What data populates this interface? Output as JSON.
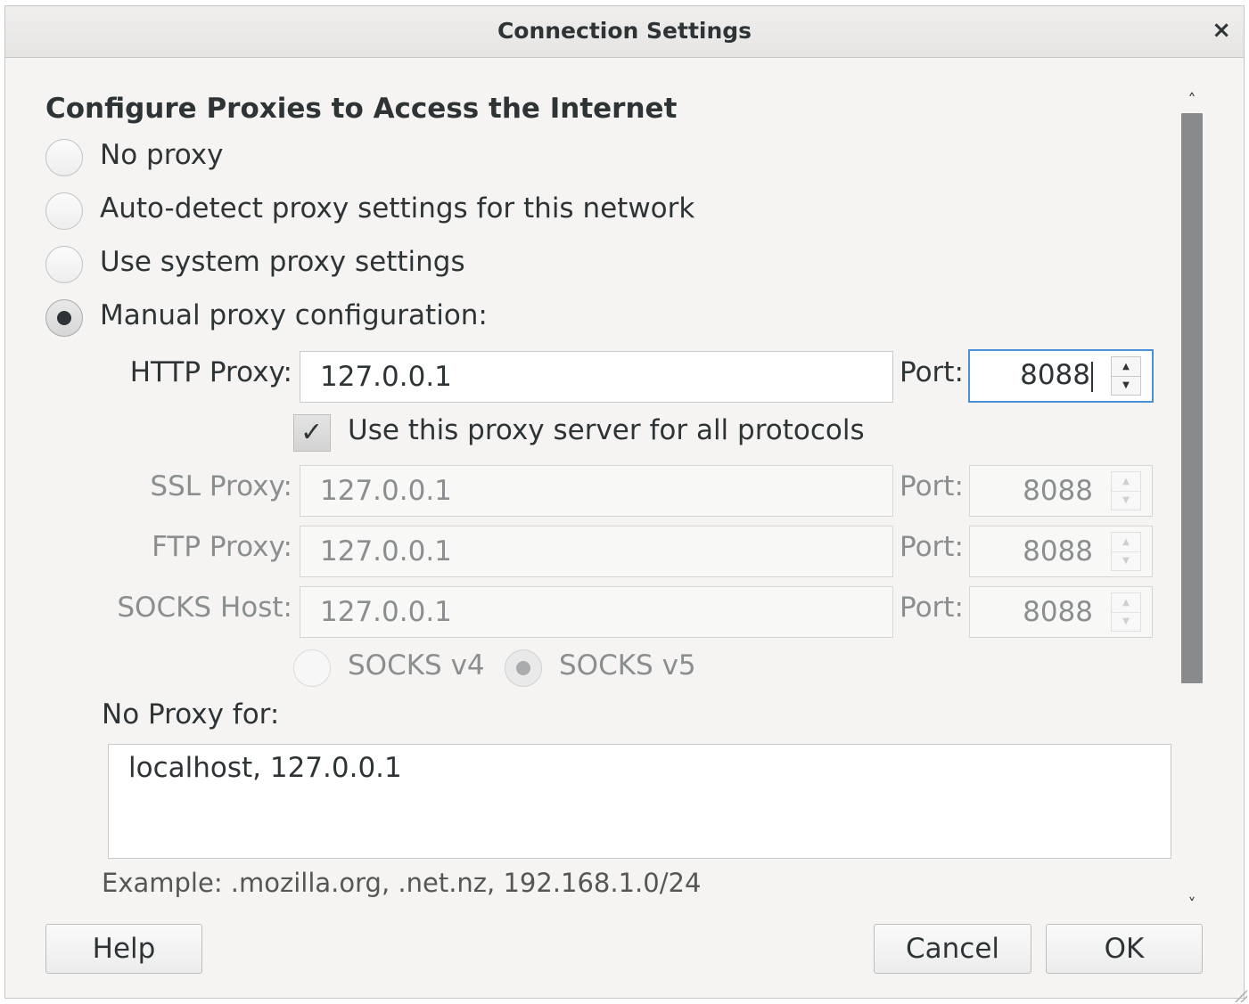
{
  "window": {
    "title": "Connection Settings",
    "close_glyph": "×"
  },
  "heading": "Configure Proxies to Access the Internet",
  "proxy_options": [
    {
      "label": "No proxy",
      "selected": false
    },
    {
      "label": "Auto-detect proxy settings for this network",
      "selected": false
    },
    {
      "label": "Use system proxy settings",
      "selected": false
    },
    {
      "label": "Manual proxy configuration:",
      "selected": true
    }
  ],
  "http": {
    "label": "HTTP Proxy:",
    "value": "127.0.0.1",
    "port_label": "Port:",
    "port": "8088"
  },
  "use_for_all": {
    "label": "Use this proxy server for all protocols",
    "checked": true
  },
  "ssl": {
    "label": "SSL Proxy:",
    "value": "127.0.0.1",
    "port_label": "Port:",
    "port": "8088"
  },
  "ftp": {
    "label": "FTP Proxy:",
    "value": "127.0.0.1",
    "port_label": "Port:",
    "port": "8088"
  },
  "socks": {
    "label": "SOCKS Host:",
    "value": "127.0.0.1",
    "port_label": "Port:",
    "port": "8088"
  },
  "socks_version": [
    {
      "label": "SOCKS v4",
      "selected": false
    },
    {
      "label": "SOCKS v5",
      "selected": true
    }
  ],
  "no_proxy": {
    "label": "No Proxy for:",
    "value": "localhost, 127.0.0.1",
    "example": "Example: .mozilla.org, .net.nz, 192.168.1.0/24"
  },
  "buttons": {
    "help": "Help",
    "cancel": "Cancel",
    "ok": "OK"
  },
  "colors": {
    "focus_border": "#4a90d9",
    "scroll_thumb": "#898a8b",
    "disabled_text": "#8b8e8f"
  }
}
